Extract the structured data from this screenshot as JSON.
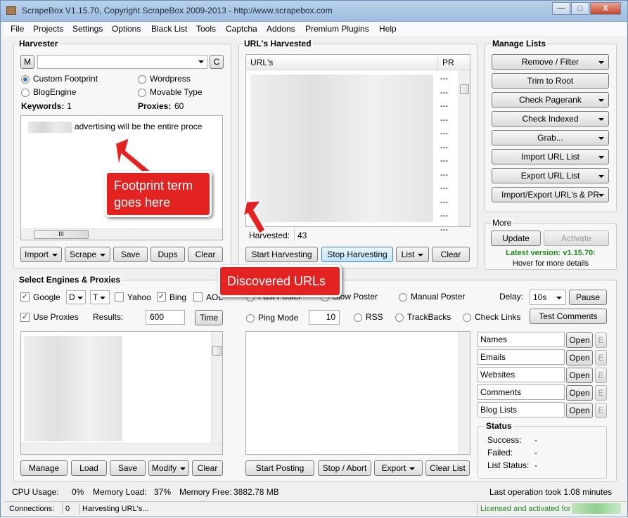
{
  "window": {
    "title": "ScrapeBox V1.15.70, Copyright ScrapeBox 2009-2013 - http://www.scrapebox.com",
    "minimize": "—",
    "maximize": "□",
    "close": "X"
  },
  "menu": [
    "File",
    "Projects",
    "Settings",
    "Options",
    "Black List",
    "Tools",
    "Captcha",
    "Addons",
    "Premium Plugins",
    "Help"
  ],
  "harvester": {
    "title": "Harvester",
    "m_button": "M",
    "c_button": "C",
    "radio_custom": "Custom Footprint",
    "radio_wordpress": "Wordpress",
    "radio_blogengine": "BlogEngine",
    "radio_movable": "Movable Type",
    "keywords_label": "Keywords:",
    "keywords_value": "1",
    "proxies_label": "Proxies:",
    "proxies_value": "60",
    "keyword_text": "advertising will be the entire proce",
    "hscroll_grip": "III",
    "buttons": {
      "import": "Import",
      "scrape": "Scrape",
      "save": "Save",
      "dups": "Dups",
      "clear": "Clear"
    }
  },
  "urls": {
    "title": "URL's Harvested",
    "col_url": "URL's",
    "col_pr": "PR",
    "pr_values": [
      "---",
      "---",
      "---",
      "---",
      "---",
      "---",
      "---",
      "---",
      "---",
      "---",
      "---",
      "---"
    ],
    "harvested_label": "Harvested:",
    "harvested_value": "43",
    "buttons": {
      "start": "Start Harvesting",
      "stop": "Stop Harvesting",
      "list": "List",
      "clear": "Clear"
    }
  },
  "manage": {
    "title": "Manage Lists",
    "buttons": [
      "Remove / Filter",
      "Trim to Root",
      "Check Pagerank",
      "Check Indexed",
      "Grab...",
      "Import URL List",
      "Export URL List",
      "Import/Export URL's & PR"
    ],
    "dropdown_flags": [
      true,
      false,
      true,
      true,
      true,
      true,
      true,
      true
    ]
  },
  "more": {
    "title": "More",
    "update": "Update",
    "activate": "Activate",
    "latest": "Latest version: v1.15.70:",
    "hover": "Hover for more details",
    "latest_color": "#1a8a1a"
  },
  "engines": {
    "title": "Select Engines & Proxies",
    "google": "Google",
    "google_opt1": "D",
    "google_opt2": "T",
    "yahoo": "Yahoo",
    "bing": "Bing",
    "aol": "AOL",
    "use_proxies": "Use Proxies",
    "results_label": "Results:",
    "results_value": "600",
    "time_button": "Time",
    "buttons": {
      "manage": "Manage",
      "load": "Load",
      "save": "Save",
      "modify": "Modify",
      "clear": "Clear"
    }
  },
  "poster": {
    "fast_poster": "Fast Poster",
    "slow_poster": "Slow Poster",
    "manual_poster": "Manual Poster",
    "delay_label": "Delay:",
    "delay_value": "10s",
    "pause": "Pause",
    "ping_mode": "Ping Mode",
    "ping_value": "10",
    "rss": "RSS",
    "trackbacks": "TrackBacks",
    "check_links": "Check Links",
    "test_comments": "Test Comments",
    "files": [
      "Names",
      "Emails",
      "Websites",
      "Comments",
      "Blog Lists"
    ],
    "open": "Open",
    "e": "E",
    "status_title": "Status",
    "success_label": "Success:",
    "success_value": "-",
    "failed_label": "Failed:",
    "failed_value": "-",
    "liststatus_label": "List Status:",
    "liststatus_value": "-",
    "buttons": {
      "start": "Start Posting",
      "stop": "Stop / Abort",
      "export": "Export",
      "clear": "Clear List"
    }
  },
  "bottom": {
    "cpu_label": "CPU Usage:",
    "cpu_value": "0%",
    "mem_label": "Memory Load:",
    "mem_value": "37%",
    "free_label": "Memory Free:",
    "free_value": "3882.78 MB",
    "last_op": "Last operation took 1:08 minutes"
  },
  "statusbar": {
    "connections_label": "Connections:",
    "connections_value": "0",
    "activity": "Harvesting URL's...",
    "license": "Licensed and activated for",
    "license_color": "#1a8a1a"
  },
  "annotations": {
    "footprint": "Footprint term goes here",
    "discovered": "Discovered URLs",
    "color": "#e32222"
  }
}
